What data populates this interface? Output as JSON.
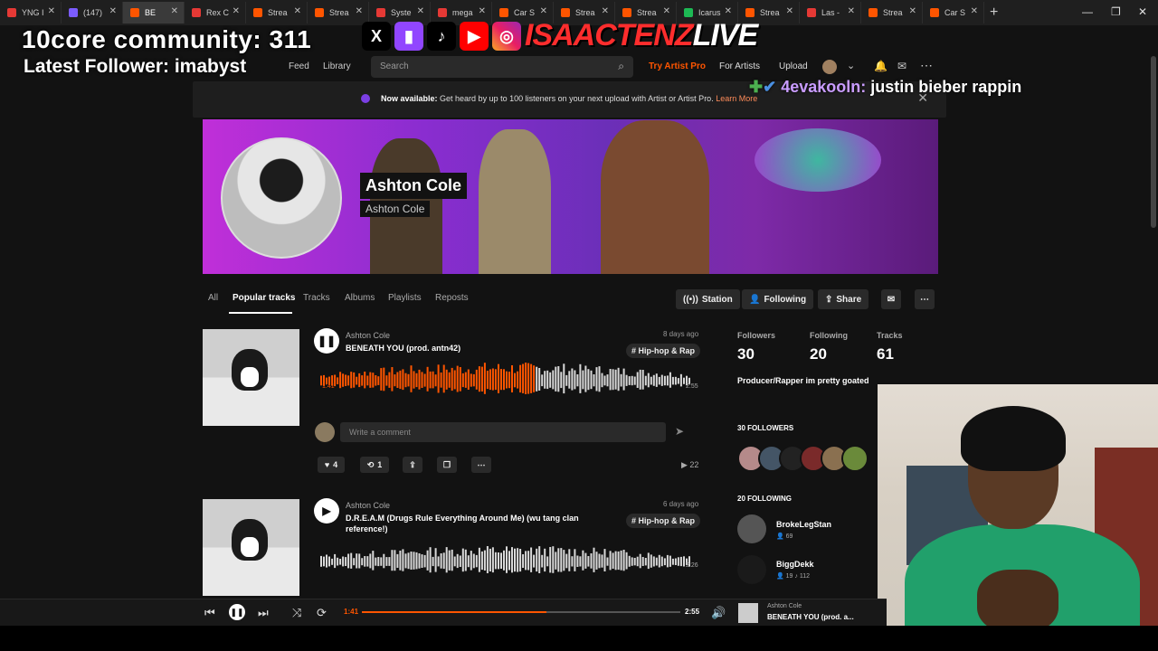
{
  "browser": {
    "tabs": [
      {
        "label": "YNG I",
        "fav": "red"
      },
      {
        "label": "(147)",
        "fav": "purple"
      },
      {
        "label": "BE",
        "fav": "orange",
        "active": true
      },
      {
        "label": "Rex C",
        "fav": "red"
      },
      {
        "label": "Strea",
        "fav": "orange"
      },
      {
        "label": "Strea",
        "fav": "orange"
      },
      {
        "label": "Syste",
        "fav": "red"
      },
      {
        "label": "mega",
        "fav": "red"
      },
      {
        "label": "Car S",
        "fav": "orange"
      },
      {
        "label": "Strea",
        "fav": "orange"
      },
      {
        "label": "Strea",
        "fav": "orange"
      },
      {
        "label": "Icarus",
        "fav": "green"
      },
      {
        "label": "Strea",
        "fav": "orange"
      },
      {
        "label": "Las -",
        "fav": "red"
      },
      {
        "label": "Strea",
        "fav": "orange"
      },
      {
        "label": "Car S",
        "fav": "orange"
      }
    ],
    "new_tab": "+",
    "min": "—",
    "max": "❐",
    "close": "✕"
  },
  "overlay": {
    "line1": "10core community: 311",
    "line2": "Latest Follower: imabyst",
    "brand_red": "ISAACTENZ",
    "brand_white": "LIVE",
    "chat_user": "4evakooln:",
    "chat_msg": "justin bieber rappin"
  },
  "nav": {
    "feed": "Feed",
    "library": "Library",
    "search_placeholder": "Search",
    "try_artist_pro": "Try Artist Pro",
    "for_artists": "For Artists",
    "upload": "Upload"
  },
  "notice": {
    "bold": "Now available:",
    "text": " Get heard by up to 100 listeners on your next upload with Artist or Artist Pro. ",
    "link": "Learn More"
  },
  "artist": {
    "name": "Ashton Cole",
    "subname": "Ashton Cole"
  },
  "profile_tabs": [
    "All",
    "Popular tracks",
    "Tracks",
    "Albums",
    "Playlists",
    "Reposts"
  ],
  "actions": {
    "station": "Station",
    "following": "Following",
    "share": "Share"
  },
  "tracks": [
    {
      "artist": "Ashton Cole",
      "title": "BENEATH YOU (prod. antn42)",
      "date": "8 days ago",
      "tag": "# Hip-hop & Rap",
      "played_time": "1:41",
      "duration": "2:55",
      "progress": 0.58,
      "likes": "4",
      "reposts": "1",
      "plays": "22"
    },
    {
      "artist": "Ashton Cole",
      "title_line1": "D.R.E.A.M (Drugs Rule Everything Around Me) (wu tang clan",
      "title_line2": "reference!)",
      "date": "6 days ago",
      "tag": "# Hip-hop & Rap",
      "duration": "2:26"
    }
  ],
  "comment_placeholder": "Write a comment",
  "stats": {
    "followers_label": "Followers",
    "followers": "30",
    "following_label": "Following",
    "following": "20",
    "tracks_label": "Tracks",
    "tracks": "61",
    "bio": "Producer/Rapper im pretty goated",
    "followers_section": "30 FOLLOWERS",
    "following_section": "20 FOLLOWING",
    "following_users": [
      {
        "name": "BrokeLegStan",
        "meta": "👤 69"
      },
      {
        "name": "BiggDekk",
        "meta": "👤 19  ♪ 112"
      }
    ]
  },
  "player": {
    "current": "1:41",
    "total": "2:55",
    "progress": 0.58,
    "now_artist": "Ashton Cole",
    "now_title": "BENEATH YOU (prod. a..."
  }
}
